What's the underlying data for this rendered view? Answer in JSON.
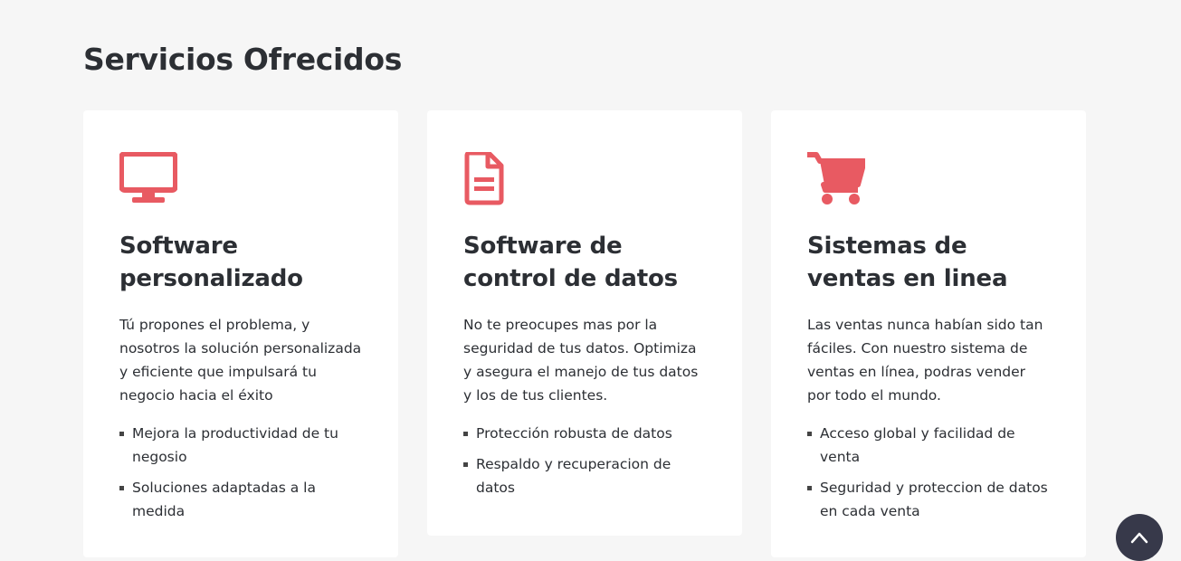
{
  "section": {
    "title": "Servicios Ofrecidos"
  },
  "accent_color": "#e85a62",
  "cards": [
    {
      "icon": "monitor-icon",
      "title": "Software personalizado",
      "description": "Tú propones el problema, y nosotros la solución personalizada y eficiente que impulsará tu negocio hacia el éxito",
      "features": [
        "Mejora la productividad de tu negosio",
        "Soluciones adaptadas a la medida"
      ]
    },
    {
      "icon": "document-icon",
      "title": "Software de control de datos",
      "description": "No te preocupes mas por la seguridad de tus datos. Optimiza y asegura el manejo de tus datos y los de tus clientes.",
      "features": [
        "Protección robusta de datos",
        "Respaldo y recuperacion de datos"
      ]
    },
    {
      "icon": "shopping-cart-icon",
      "title": "Sistemas de ventas en linea",
      "description": "Las ventas nunca habían sido tan fáciles. Con nuestro sistema de ventas en línea, podras vender por todo el mundo.",
      "features": [
        "Acceso global y facilidad de venta",
        "Seguridad y proteccion de datos en cada venta"
      ]
    }
  ],
  "scroll_top": {
    "icon": "chevron-up-icon"
  }
}
